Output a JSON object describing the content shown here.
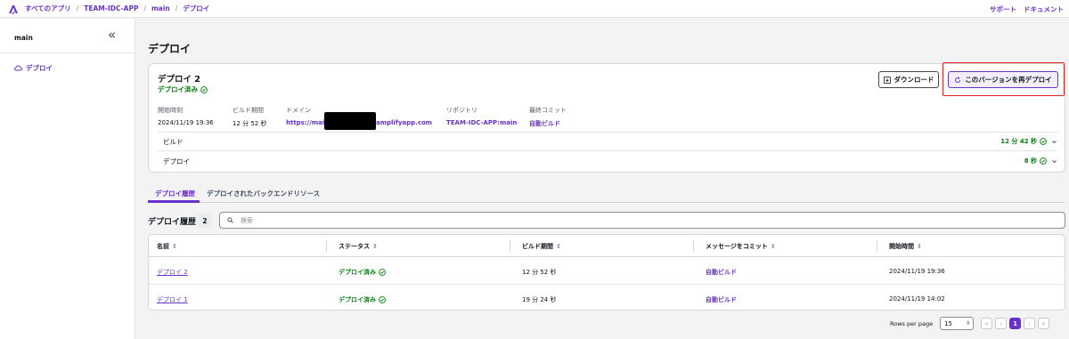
{
  "breadcrumb": [
    "すべてのアプリ",
    "TEAM-IDC-APP",
    "main",
    "デプロイ"
  ],
  "top_links": {
    "support": "サポート",
    "docs": "ドキュメント"
  },
  "sidebar": {
    "title": "main",
    "items": [
      {
        "label": "デプロイ"
      }
    ]
  },
  "page_title": "デプロイ",
  "deployment": {
    "title": "デプロイ 2",
    "status": "デプロイ済み",
    "download_label": "ダウンロード",
    "redeploy_label": "このバージョンを再デプロイ",
    "meta": [
      {
        "label": "開始時刻",
        "value": "2024/11/19 19:36"
      },
      {
        "label": "ビルド期間",
        "value": "12 分 52 秒"
      },
      {
        "label": "ドメイン",
        "value": "https://main",
        "value_suffix": "amplifyapp.com"
      },
      {
        "label": "リポジトリ",
        "value": "TEAM-IDC-APP:main"
      },
      {
        "label": "最終コミット",
        "value": "自動ビルド"
      }
    ],
    "steps": [
      {
        "name": "ビルド",
        "time": "12 分 42 秒"
      },
      {
        "name": "デプロイ",
        "time": "8 秒"
      }
    ]
  },
  "tabs": [
    "デプロイ履歴",
    "デプロイされたバックエンドリソース"
  ],
  "history": {
    "title": "デプロイ履歴",
    "count": "2",
    "search_placeholder": "検索",
    "columns": [
      "名前",
      "ステータス",
      "ビルド期間",
      "メッセージをコミット",
      "開始時間"
    ],
    "rows": [
      {
        "name": "デプロイ 2",
        "status": "デプロイ済み",
        "duration": "12 分 52 秒",
        "message": "自動ビルド",
        "start": "2024/11/19 19:36"
      },
      {
        "name": "デプロイ 1",
        "status": "デプロイ済み",
        "duration": "19 分 24 秒",
        "message": "自動ビルド",
        "start": "2024/11/19 14:02"
      }
    ]
  },
  "pagination": {
    "rows_per_page_label": "Rows per page",
    "rows_per_page": "15",
    "current_page": "1"
  },
  "colors": {
    "accent": "#6a32c9",
    "success": "#037f0c",
    "highlight": "#e02020"
  }
}
